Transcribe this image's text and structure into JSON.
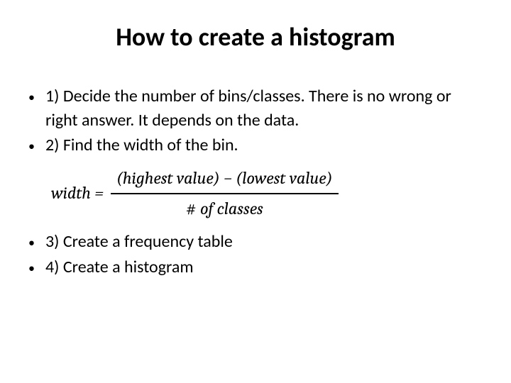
{
  "title": "How to create a histogram",
  "bullet": "•",
  "steps": {
    "s1": "1) Decide the number of bins/classes. There is no wrong or right answer. It depends on the data.",
    "s2": "2) Find the width of the bin.",
    "s3": "3) Create a frequency table",
    "s4": "4) Create a histogram"
  },
  "formula": {
    "lhs": "width =",
    "numerator": "(highest value) − (lowest value)",
    "denominator_prefix": "# ",
    "denominator_rest": "of classes"
  }
}
